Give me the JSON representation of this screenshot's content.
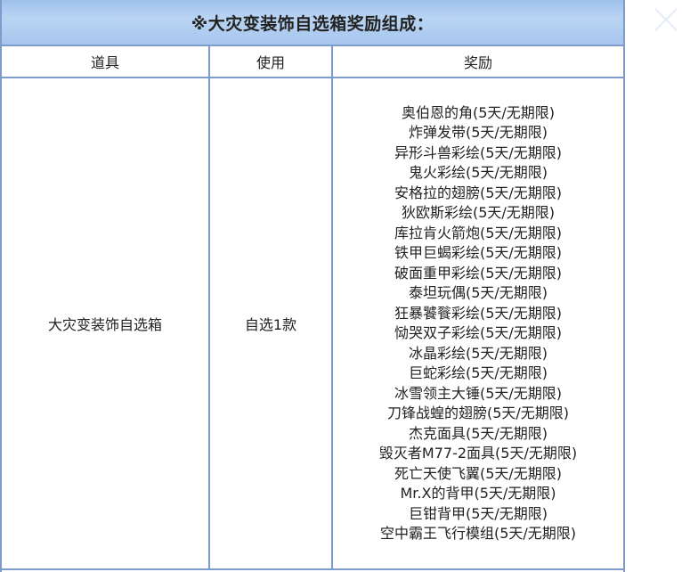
{
  "banner": {
    "title": "※大灾变装饰自选箱奖励组成："
  },
  "table": {
    "headers": [
      "道具",
      "使用",
      "奖励"
    ],
    "row": {
      "item": "大灾变装饰自选箱",
      "usage": "自选1款",
      "rewards": [
        "奥伯恩的角(5天/无期限)",
        "炸弹发带(5天/无期限)",
        "异形斗兽彩绘(5天/无期限)",
        "鬼火彩绘(5天/无期限)",
        "安格拉的翅膀(5天/无期限)",
        "狄欧斯彩绘(5天/无期限)",
        "库拉肯火箭炮(5天/无期限)",
        "铁甲巨蝎彩绘(5天/无期限)",
        "破面重甲彩绘(5天/无期限)",
        "泰坦玩偶(5天/无期限)",
        "狂暴饕餮彩绘(5天/无期限)",
        "恸哭双子彩绘(5天/无期限)",
        "冰晶彩绘(5天/无期限)",
        "巨蛇彩绘(5天/无期限)",
        "冰雪领主大锤(5天/无期限)",
        "刀锋战蝗的翅膀(5天/无期限)",
        "杰克面具(5天/无期限)",
        "毁灭者M77-2面具(5天/无期限)",
        "死亡天使飞翼(5天/无期限)",
        "Mr.X的背甲(5天/无期限)",
        "巨钳背甲(5天/无期限)",
        "空中霸王飞行模组(5天/无期限)"
      ]
    }
  },
  "colors": {
    "border": "#7e9ccb",
    "banner": "#b9d4f3",
    "text": "#222222"
  },
  "icons": {
    "close": "close-icon"
  }
}
